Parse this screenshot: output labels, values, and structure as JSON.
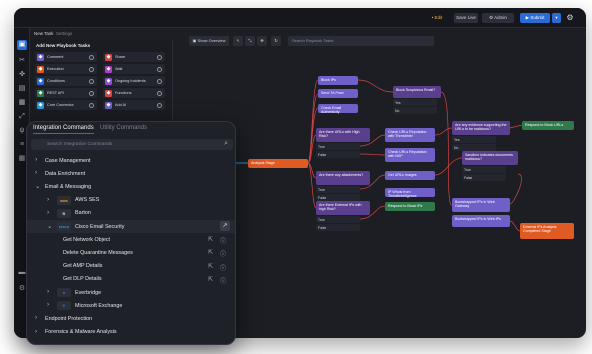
{
  "topbar": {
    "edit_label": "• Edit",
    "view_label": "Save Live",
    "admin_label": "⚙ Admin",
    "submit_label": "▶ Submit",
    "share_label": "▾"
  },
  "subbar": {
    "title": "New Task",
    "settings": "Settings"
  },
  "playbook": {
    "title": "Add New Playbook Tasks",
    "items": [
      {
        "label": "Comment",
        "color": "#6e5fc9"
      },
      {
        "label": "Share",
        "color": "#d64545"
      },
      {
        "label": "Execution",
        "color": "#e05a24"
      },
      {
        "label": "Wait",
        "color": "#b03fbf"
      },
      {
        "label": "Conditions",
        "color": "#2a6bd6"
      },
      {
        "label": "Ongoing Incidents",
        "color": "#8a4fd6"
      },
      {
        "label": "REST API",
        "color": "#2f7a4a"
      },
      {
        "label": "Functions",
        "color": "#d64545"
      },
      {
        "label": "Core Connector",
        "color": "#2a9bd6"
      },
      {
        "label": "Add AI",
        "color": "#6e5fc9"
      }
    ]
  },
  "canvas": {
    "show_overview": "▣ Show Overview",
    "search_placeholder": "Search Playbook Tasks"
  },
  "nodes": [
    {
      "label": "Block IPs",
      "kind": "blue"
    },
    {
      "label": "Send TA Push",
      "kind": "blue"
    },
    {
      "label": "Check Email Authenticity",
      "kind": "blue"
    },
    {
      "label": "Block Suspicious Email?",
      "kind": "purple"
    },
    {
      "label": "Are there URLs with High Risk?",
      "kind": "purple"
    },
    {
      "label": "Check URLs Reputation with ThreatIntel",
      "kind": "blue"
    },
    {
      "label": "Check URLs Reputation with NSP",
      "kind": "blue"
    },
    {
      "label": "Are there any attachments?",
      "kind": "purple"
    },
    {
      "label": "Are there External IPs with high Risk?",
      "kind": "purple"
    },
    {
      "label": "Get URLs Images",
      "kind": "blue"
    },
    {
      "label": "IP Whois from ThreatIntelligence",
      "kind": "blue"
    },
    {
      "label": "Respond to Block IPs",
      "kind": "green"
    },
    {
      "label": "Analysis Stage",
      "kind": "orange"
    },
    {
      "label": "Are any evidence supporting the URLs to be malicious?",
      "kind": "purple"
    },
    {
      "label": "Sandbox indicates documents malicious?",
      "kind": "purple"
    },
    {
      "label": "Bootstrapped IPs in Web Gateway",
      "kind": "blue"
    },
    {
      "label": "Bootstrapped IPs in Web IPs",
      "kind": "blue"
    },
    {
      "label": "Respond to Block URLs",
      "kind": "green"
    },
    {
      "label": "External IPs Analysis Completed Stage",
      "kind": "orange"
    }
  ],
  "conditions": {
    "yes": "Yes",
    "no": "No",
    "true": "True",
    "false": "False"
  },
  "panel": {
    "tab_active": "Integration Commands",
    "tab_inactive": "Utility Commands",
    "search_placeholder": "Search Integration Commands",
    "rows": [
      {
        "label": "Case Management",
        "level": 0,
        "chevron": "›"
      },
      {
        "label": "Data Enrichment",
        "level": 0,
        "chevron": "›"
      },
      {
        "label": "Email & Messaging",
        "level": 0,
        "chevron": "⌄"
      },
      {
        "label": "AWS SES",
        "level": 1,
        "chevron": "›",
        "logo": "aws",
        "logo_color": "#ff9900"
      },
      {
        "label": "Barton",
        "level": 1,
        "chevron": "›",
        "logo": "B",
        "logo_color": "#cfd3dc"
      },
      {
        "label": "Cisco Email Security",
        "level": 1,
        "chevron": "⌄",
        "logo": "cisco",
        "logo_color": "#1ba0d7"
      },
      {
        "label": "Get Network Object",
        "level": 2
      },
      {
        "label": "Delete Quarantine Messages",
        "level": 2
      },
      {
        "label": "Get AMP Details",
        "level": 2
      },
      {
        "label": "Get DLP Details",
        "level": 2
      },
      {
        "label": "Everbridge",
        "level": 1,
        "chevron": "›",
        "logo": "●",
        "logo_color": "#7a5cf0"
      },
      {
        "label": "Microsoft Exchange",
        "level": 1,
        "chevron": "›",
        "logo": "E",
        "logo_color": "#2a6bd6"
      },
      {
        "label": "Endpoint Protection",
        "level": 0,
        "chevron": "›"
      },
      {
        "label": "Forensics & Malware Analysis",
        "level": 0,
        "chevron": "›"
      }
    ]
  },
  "colors": {
    "accent": "#2a6bd6",
    "bg": "#1c1e24",
    "orange": "#e05a24"
  },
  "icons": [
    "gear-icon",
    "search-icon",
    "chevron-right-icon",
    "chevron-down-icon",
    "help-icon",
    "external-link-icon"
  ]
}
